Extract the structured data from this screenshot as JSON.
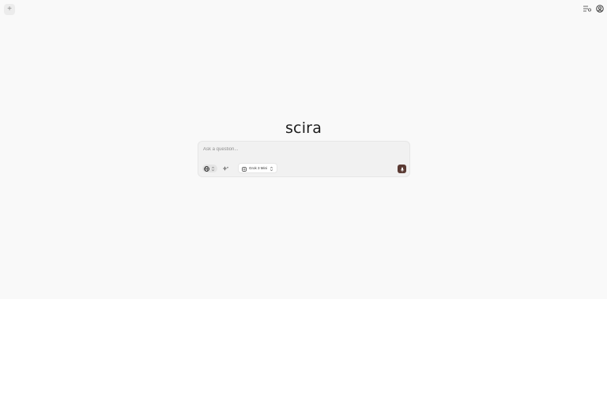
{
  "header": {
    "new_chat_symbol": "+",
    "icons": [
      "history-list-icon",
      "account-circle-icon"
    ]
  },
  "brand": {
    "title": "scira"
  },
  "composer": {
    "placeholder": "Ask a question...",
    "value": "",
    "search_group_icon": "globe-icon",
    "extra_tool_icon": "sparkles-icon",
    "model": {
      "selected": "Grok 3 Mini",
      "icon": "model-chip-icon"
    },
    "send_icon": "microphone-icon"
  },
  "colors": {
    "background": "#f9f9f9",
    "composer_bg": "#f1f1f1",
    "send_button": "#5a3a33"
  }
}
